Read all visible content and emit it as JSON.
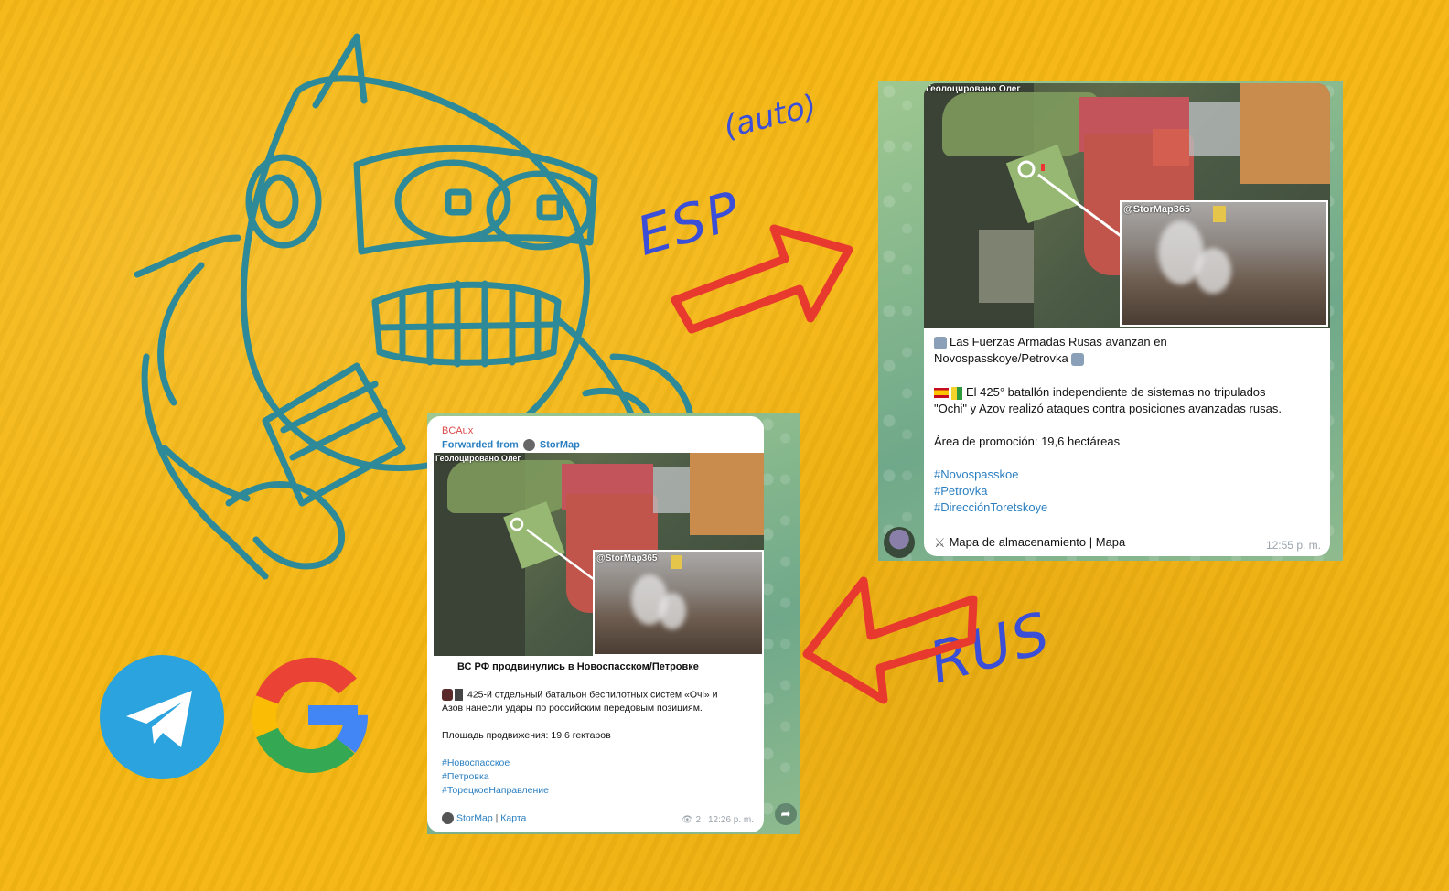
{
  "labels": {
    "auto": "(auto)",
    "esp": "ESP",
    "rus": "RUS"
  },
  "colors": {
    "background": "#f5b713",
    "robot_line": "#2e8a99",
    "arrow": "#e8392f",
    "handwriting": "#3a4ed8",
    "telegram": "#2aa3df",
    "link": "#2a7fc1"
  },
  "icons": [
    "robot-drawing",
    "telegram-logo",
    "google-logo",
    "arrow-right",
    "arrow-left"
  ],
  "esp_card": {
    "map_title": "Геолоцировано Олег",
    "inset_title": "@StorMap365",
    "headline_1": "Las Fuerzas Armadas Rusas avanzan en",
    "headline_2": "Novospasskoye/Petrovka",
    "body_1": "El 425° batallón independiente de sistemas no tripulados",
    "body_2": "\"Ochi\" y Azov realizó ataques contra posiciones avanzadas rusas.",
    "area": "Área de promoción: 19,6 hectáreas",
    "tags": [
      "#Novospasskoe",
      "#Petrovka",
      "#DirecciónToretskoye"
    ],
    "footer": "Mapa de almacenamiento | Mapa",
    "time": "12:55 p. m."
  },
  "rus_card": {
    "channel": "BCAux",
    "forwarded_prefix": "Forwarded from",
    "forwarded_name": "StorMap",
    "map_title": "Геолоцировано Олег",
    "inset_title": "@StorMap365",
    "headline": "ВС РФ продвинулись в Новоспасском/Петровке",
    "body_1": "425-й отдельный батальон беспилотных систем «Очі» и",
    "body_2": "Азов нанесли удары по российским передовым позициям.",
    "area": "Площадь продвижения: 19,6 гектаров",
    "tags": [
      "#Новоспасское",
      "#Петровка",
      "#ТорецкоеНаправление"
    ],
    "footer_link_1": "StorMap",
    "footer_sep": "|",
    "footer_link_2": "Карта",
    "views": "2",
    "time": "12:26 p. m."
  }
}
